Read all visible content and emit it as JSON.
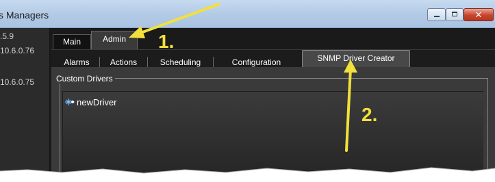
{
  "window": {
    "title": "s Managers",
    "controls": {
      "minimize": "minimize-icon",
      "maximize": "maximize-icon",
      "close": "close-icon"
    }
  },
  "hosts": [
    ".5.9",
    "10.6.0.76",
    "10.6.0.75"
  ],
  "top_tabs": [
    {
      "label": "Main",
      "selected": false
    },
    {
      "label": "Admin",
      "selected": true
    }
  ],
  "sub_tabs": [
    {
      "label": "Alarms",
      "selected": false
    },
    {
      "label": "Actions",
      "selected": false
    },
    {
      "label": "Scheduling",
      "selected": false
    },
    {
      "label": "Configuration",
      "selected": false
    },
    {
      "label": "SNMP Driver Creator",
      "selected": true
    }
  ],
  "custom_drivers": {
    "group_title": "Custom Drivers",
    "items": [
      {
        "label": "newDriver",
        "icon": "driver-icon"
      }
    ]
  },
  "annotations": {
    "step1": "1.",
    "step2": "2.",
    "color": "#f2e03c"
  },
  "colors": {
    "panel_bg": "#3a3a3a",
    "dark_bg": "#1a1a1a",
    "selected_tab": "#484848"
  }
}
